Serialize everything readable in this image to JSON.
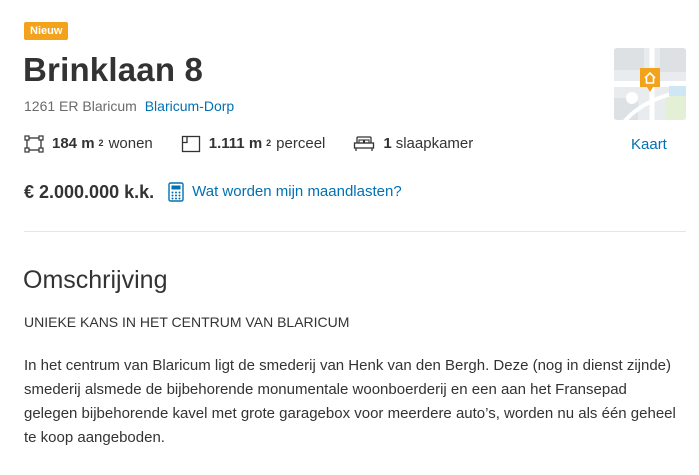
{
  "listing": {
    "badge": "Nieuw",
    "title": "Brinklaan 8",
    "postal_city": "1261 ER Blaricum",
    "neighbourhood": "Blaricum-Dorp",
    "features": {
      "living": {
        "value": "184 m",
        "sup": "2",
        "label": "wonen",
        "icon": "living-area-icon"
      },
      "plot": {
        "value": "1.111 m",
        "sup": "2",
        "label": "perceel",
        "icon": "plot-area-icon"
      },
      "bedrooms": {
        "value": "1",
        "label": "slaapkamer",
        "icon": "bed-icon"
      }
    },
    "map_link": "Kaart",
    "price": "€ 2.000.000 k.k.",
    "monthly_link": "Wat worden mijn maandlasten?"
  },
  "description": {
    "heading": "Omschrijving",
    "intro": "UNIEKE KANS IN HET CENTRUM VAN BLARICUM",
    "body": "In het centrum van Blaricum ligt de smederij van Henk van den Bergh. Deze (nog in dienst zijnde) smederij alsmede de bijbehorende monumentale woonboerderij en een aan het Fransepad gelegen bijbehorende kavel met grote garagebox voor meerdere auto’s, worden nu als één geheel te koop aangeboden."
  },
  "colors": {
    "accent": "#0071b3",
    "badge": "#f3a21b",
    "text": "#333333",
    "muted": "#6b6b6b"
  }
}
